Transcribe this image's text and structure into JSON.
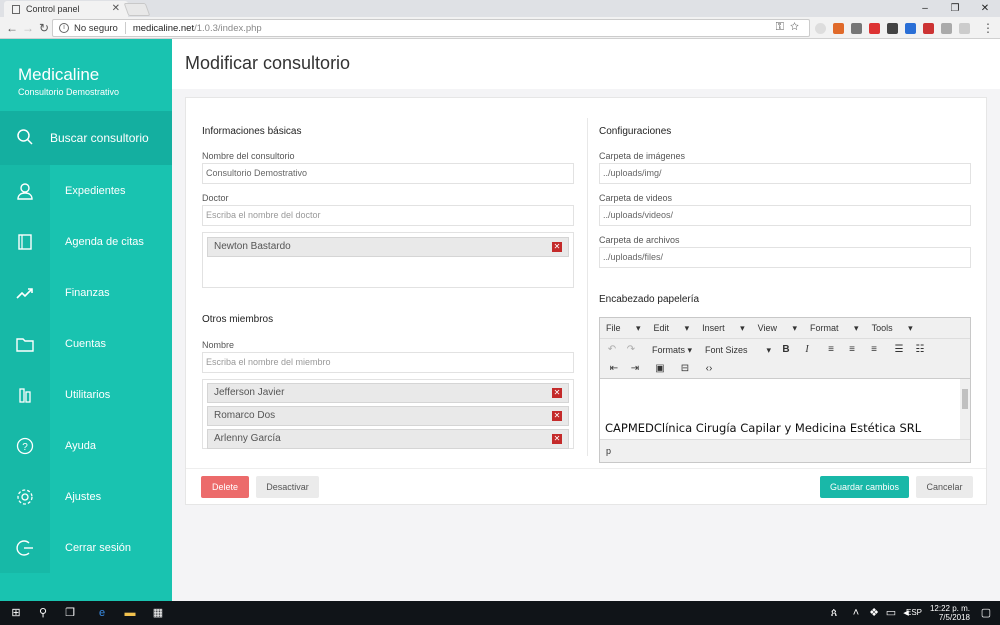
{
  "browser": {
    "tab_title": "Control panel",
    "security_label": "No seguro",
    "url_host": "medicaline.net",
    "url_path": "/1.0.3/index.php"
  },
  "sidebar": {
    "brand_name": "Medicaline",
    "brand_sub": "Consultorio Demostrativo",
    "search_label": "Buscar consultorio",
    "items": [
      {
        "label": "Expedientes",
        "icon": "user-icon"
      },
      {
        "label": "Agenda de citas",
        "icon": "agenda-icon"
      },
      {
        "label": "Finanzas",
        "icon": "trend-icon"
      },
      {
        "label": "Cuentas",
        "icon": "folder-icon"
      },
      {
        "label": "Utilitarios",
        "icon": "tools-icon"
      },
      {
        "label": "Ayuda",
        "icon": "help-icon"
      },
      {
        "label": "Ajustes",
        "icon": "gear-icon"
      },
      {
        "label": "Cerrar sesión",
        "icon": "logout-icon"
      }
    ]
  },
  "page": {
    "title": "Modificar consultorio"
  },
  "basic": {
    "section_title": "Informaciones básicas",
    "name_label": "Nombre del consultorio",
    "name_value": "Consultorio Demostrativo",
    "doctor_label": "Doctor",
    "doctor_placeholder": "Escriba el nombre del doctor",
    "doctors": [
      "Newton Bastardo"
    ]
  },
  "members": {
    "section_title": "Otros miembros",
    "name_label": "Nombre",
    "name_placeholder": "Escriba el nombre del miembro",
    "list": [
      "Jefferson Javier",
      "Romarco Dos",
      "Arlenny García"
    ]
  },
  "config": {
    "section_title": "Configuraciones",
    "images_label": "Carpeta de imágenes",
    "images_value": "../uploads/img/",
    "videos_label": "Carpeta de videos",
    "videos_value": "../uploads/videos/",
    "files_label": "Carpeta de archivos",
    "files_value": "../uploads/files/",
    "header_label": "Encabezado papelería"
  },
  "editor": {
    "menu": [
      "File",
      "Edit",
      "Insert",
      "View",
      "Format",
      "Tools"
    ],
    "formats_label": "Formats",
    "font_sizes_label": "Font Sizes",
    "content": "CAPMEDClínica Cirugía Capilar y Medicina Estética SRL",
    "status_path": "p"
  },
  "actions": {
    "delete": "Delete",
    "deactivate": "Desactivar",
    "save": "Guardar cambios",
    "cancel": "Cancelar"
  },
  "taskbar": {
    "lang": "ESP",
    "time": "12:22 p. m.",
    "date": "7/5/2018"
  },
  "colors": {
    "sidebar": "#19c3b0",
    "accent": "#19b8a8",
    "danger": "#ec6b6b"
  }
}
